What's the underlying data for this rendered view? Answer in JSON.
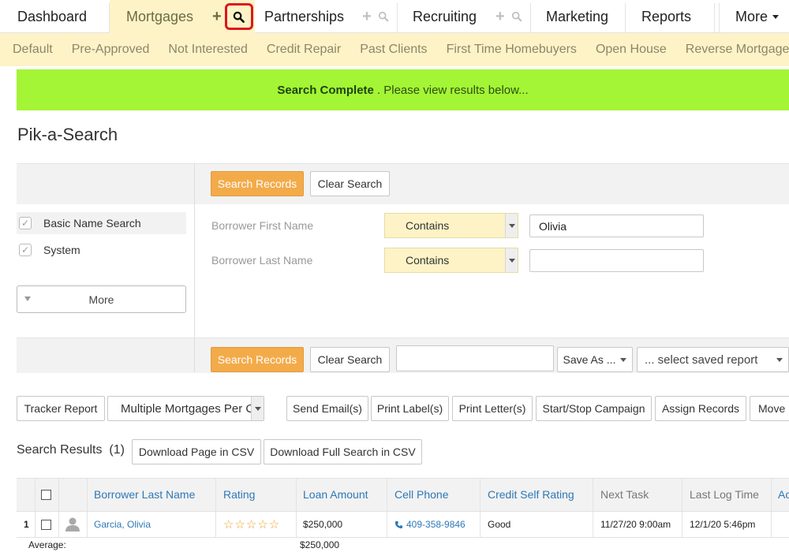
{
  "nav": {
    "tabs": [
      "Dashboard",
      "Mortgages",
      "Partnerships",
      "Recruiting",
      "Marketing",
      "Reports"
    ],
    "more": "More"
  },
  "subnav": [
    "Default",
    "Pre-Approved",
    "Not Interested",
    "Credit Repair",
    "Past Clients",
    "First Time Homebuyers",
    "Open House",
    "Reverse Mortgage"
  ],
  "banner": {
    "bold": "Search Complete",
    "rest": ". Please view results below..."
  },
  "page_title": "Pik-a-Search",
  "search": {
    "search_btn": "Search Records",
    "clear_btn": "Clear Search",
    "filters": [
      "Basic Name Search",
      "System"
    ],
    "more_btn": "More",
    "fields": [
      {
        "label": "Borrower First Name",
        "operator": "Contains",
        "value": "Olivia"
      },
      {
        "label": "Borrower Last Name",
        "operator": "Contains",
        "value": ""
      }
    ],
    "save_as": "Save As ...",
    "saved_report_placeholder": "... select saved report"
  },
  "toolbar": {
    "tracker": "Tracker Report",
    "multi": "Multiple Mortgages Per C",
    "send_email": "Send Email(s)",
    "print_label": "Print Label(s)",
    "print_letter": "Print Letter(s)",
    "campaign": "Start/Stop Campaign",
    "assign": "Assign Records",
    "move": "Move I"
  },
  "results": {
    "title": "Search Results",
    "count": "(1)",
    "download_page": "Download Page in CSV",
    "download_full": "Download Full Search in CSV"
  },
  "table": {
    "columns": [
      "Borrower Last Name",
      "Rating",
      "Loan Amount",
      "Cell Phone",
      "Credit Self Rating",
      "Next Task",
      "Last Log Time",
      "Ac"
    ],
    "rows": [
      {
        "num": "1",
        "name": "Garcia, Olivia",
        "rating": "☆☆☆☆☆",
        "loan": "$250,000",
        "phone": "409-358-9846",
        "credit": "Good",
        "next_task": "11/27/20 9:00am",
        "last_log": "12/1/20 5:46pm"
      }
    ],
    "average_label": "Average:",
    "average_loan": "$250,000"
  },
  "colors": {
    "accent_orange": "#f3ab4a",
    "banner_green": "#a4f535",
    "tab_yellow": "#fdf3c7",
    "link_blue": "#2e78b7",
    "highlight_red": "#e0161b"
  }
}
